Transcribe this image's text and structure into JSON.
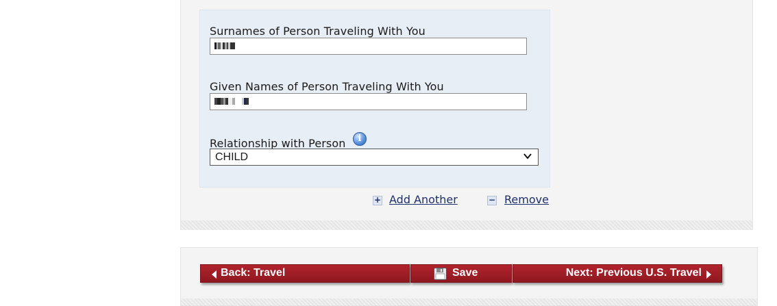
{
  "form": {
    "surnames_label": "Surnames of Person Traveling With You",
    "given_names_label": "Given Names of Person Traveling With You",
    "relationship_label": "Relationship with Person",
    "relationship_value": "CHILD",
    "info_icon": "info-icon"
  },
  "actions": {
    "add_another": "Add Another",
    "remove": "Remove",
    "add_icon": "plus-icon",
    "remove_icon": "minus-icon"
  },
  "nav": {
    "back": "Back: Travel",
    "save": "Save",
    "next": "Next: Previous U.S. Travel",
    "save_icon": "floppy-disk-icon"
  },
  "colors": {
    "button_red": "#a31f28",
    "form_bg": "#e8eef5",
    "link": "#1f2f6b"
  }
}
